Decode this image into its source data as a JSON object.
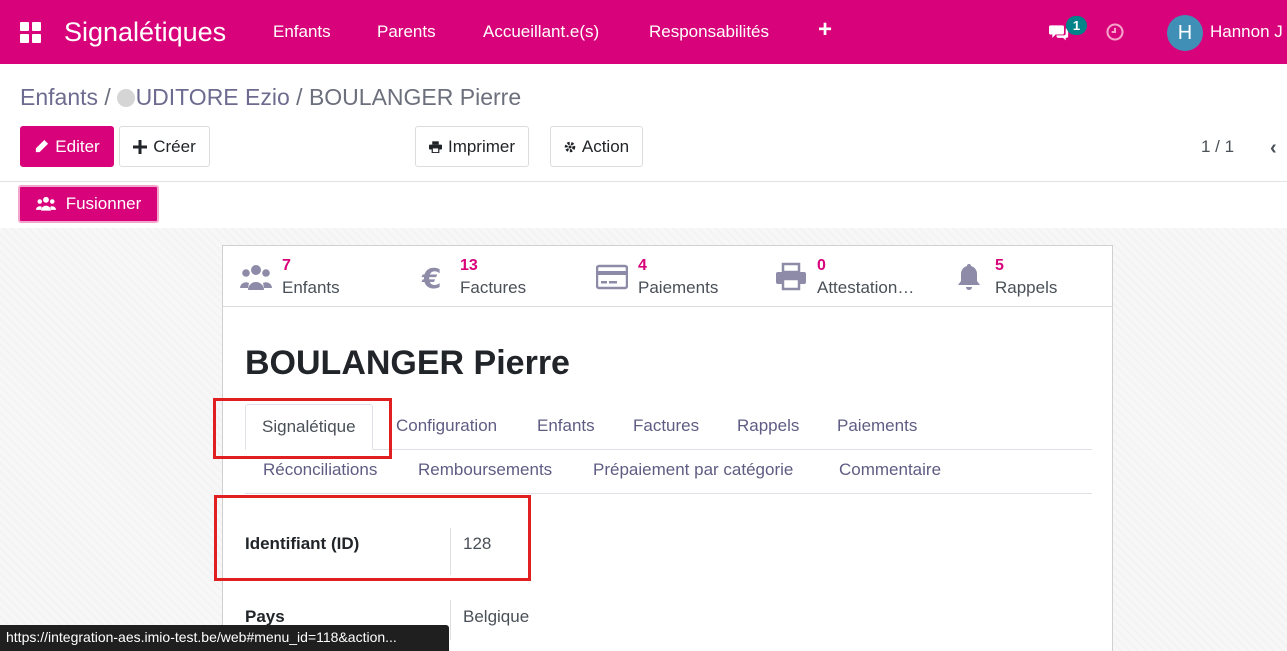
{
  "navbar": {
    "brand": "Signalétiques",
    "menu": [
      {
        "label": "Enfants"
      },
      {
        "label": "Parents"
      },
      {
        "label": "Accueillant.e(s)"
      },
      {
        "label": "Responsabilités"
      }
    ],
    "plus_label": "+",
    "chat_badge": "1",
    "avatar_initial": "H",
    "user_name": "Hannon J"
  },
  "breadcrumb": {
    "items": [
      "Enfants",
      "UDITORE Ezio"
    ],
    "separator": "/",
    "current": "BOULANGER Pierre"
  },
  "toolbar": {
    "edit_label": "Editer",
    "create_label": "Créer",
    "print_label": "Imprimer",
    "action_label": "Action",
    "pager": "1 / 1",
    "merge_label": "Fusionner"
  },
  "stats": [
    {
      "num": "7",
      "label": "Enfants",
      "icon": "users-icon"
    },
    {
      "num": "13",
      "label": "Factures",
      "icon": "euro-icon"
    },
    {
      "num": "4",
      "label": "Paiements",
      "icon": "credit-card-icon"
    },
    {
      "num": "0",
      "label": "Attestation…",
      "icon": "printer-icon"
    },
    {
      "num": "5",
      "label": "Rappels",
      "icon": "bell-icon"
    }
  ],
  "record": {
    "title": "BOULANGER Pierre"
  },
  "tabs": [
    {
      "label": "Signalétique",
      "active": true
    },
    {
      "label": "Configuration"
    },
    {
      "label": "Enfants"
    },
    {
      "label": "Factures"
    },
    {
      "label": "Rappels"
    },
    {
      "label": "Paiements"
    },
    {
      "label": "Réconciliations"
    },
    {
      "label": "Remboursements"
    },
    {
      "label": "Prépaiement par catégorie"
    },
    {
      "label": "Commentaire"
    }
  ],
  "fields": [
    {
      "label": "Identifiant (ID)",
      "value": "128"
    },
    {
      "label": "Pays",
      "value": "Belgique"
    }
  ],
  "statusbar": {
    "url": "https://integration-aes.imio-test.be/web#menu_id=118&action..."
  },
  "colors": {
    "brand": "#d8037a",
    "badge": "#00848a",
    "avatar": "#3f8fb6",
    "highlight": "#e02020"
  }
}
